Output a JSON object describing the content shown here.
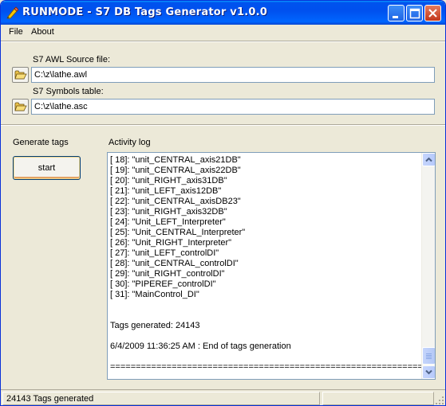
{
  "window": {
    "title": "RUNMODE - S7 DB Tags Generator v1.0.0",
    "icon": "pencil-icon",
    "accent": "#0053ee"
  },
  "menu": {
    "items": [
      {
        "label": "File"
      },
      {
        "label": "About"
      }
    ]
  },
  "source": {
    "awl_label": "S7 AWL Source file:",
    "awl_value": "C:\\z\\lathe.awl",
    "symbols_label": "S7 Symbols table:",
    "symbols_value": "C:\\z\\lathe.asc"
  },
  "generate": {
    "label": "Generate tags",
    "start_label": "start"
  },
  "log": {
    "label": "Activity log",
    "lines": [
      "[ 18]: \"unit_CENTRAL_axis21DB\"",
      "[ 19]: \"unit_CENTRAL_axis22DB\"",
      "[ 20]: \"unit_RIGHT_axis31DB\"",
      "[ 21]: \"unit_LEFT_axis12DB\"",
      "[ 22]: \"unit_CENTRAL_axisDB23\"",
      "[ 23]: \"unit_RIGHT_axis32DB\"",
      "[ 24]: \"Unit_LEFT_Interpreter\"",
      "[ 25]: \"Unit_CENTRAL_Interpreter\"",
      "[ 26]: \"Unit_RIGHT_Interpreter\"",
      "[ 27]: \"unit_LEFT_controlDI\"",
      "[ 28]: \"unit_CENTRAL_controlDI\"",
      "[ 29]: \"unit_RIGHT_controlDI\"",
      "[ 30]: \"PIPEREF_controlDI\"",
      "[ 31]: \"MainControl_DI\"",
      "",
      "",
      "Tags generated: 24143",
      "",
      "6/4/2009 11:36:25 AM : End of tags generation",
      "",
      "=============================================================="
    ]
  },
  "status": {
    "text": "24143 Tags generated"
  }
}
